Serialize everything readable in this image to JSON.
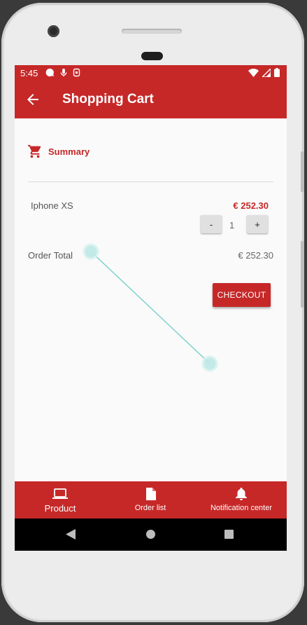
{
  "status_bar": {
    "time": "5:45",
    "left_icons": [
      "chat-bubble-icon",
      "mic-icon",
      "app-icon"
    ],
    "right_icons": [
      "wifi-icon",
      "signal-icon",
      "battery-icon"
    ]
  },
  "app_bar": {
    "title": "Shopping Cart",
    "back_icon": "arrow-left-icon",
    "color": "#c62828"
  },
  "summary": {
    "icon": "shopping-cart-icon",
    "label": "Summary"
  },
  "cart_items": [
    {
      "name": "Iphone XS",
      "price": "€ 252.30",
      "quantity": "1",
      "minus_label": "-",
      "plus_label": "+"
    }
  ],
  "order_total": {
    "label": "Order Total",
    "value": "€ 252.30"
  },
  "checkout": {
    "label": "CHECKOUT"
  },
  "bottom_nav": {
    "items": [
      {
        "label": "Product",
        "icon": "laptop-icon"
      },
      {
        "label": "Order list",
        "icon": "document-icon"
      },
      {
        "label": "Notification center",
        "icon": "bell-icon"
      }
    ]
  },
  "system_nav": [
    "back-triangle-icon",
    "home-circle-icon",
    "recents-square-icon"
  ],
  "colors": {
    "accent": "#c62828",
    "background": "#fafafa"
  }
}
